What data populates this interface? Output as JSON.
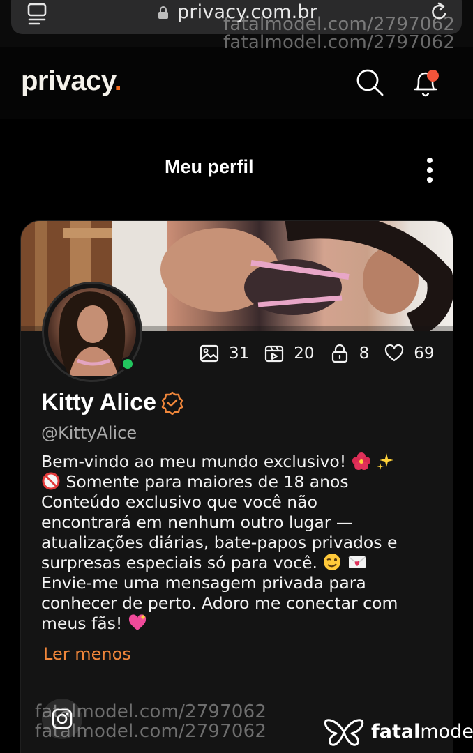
{
  "browser": {
    "url": "privacy.com.br"
  },
  "header": {
    "logo": "privacy",
    "logo_dot": "."
  },
  "page": {
    "title": "Meu perfil"
  },
  "profile": {
    "name": "Kitty Alice",
    "handle": "@KittyAlice",
    "status": "online",
    "stats": {
      "photos": "31",
      "videos": "20",
      "locked": "8",
      "likes": "69"
    },
    "bio_lines": [
      "Bem-vindo ao meu mundo exclusivo!",
      "Somente para maiores de 18 anos",
      "Conteúdo exclusivo que você não",
      "encontrará em nenhum outro lugar —",
      "atualizações diárias, bate-papos privados e",
      "surpresas especiais só para você.",
      "Envie-me uma mensagem privada para",
      "conhecer de perto. Adoro me conectar com",
      "meus fãs!"
    ],
    "read_less": "Ler menos"
  },
  "watermark": {
    "text_1": "fatalmodel.com/2797062",
    "text_2": "fatalmodel.com/2797062",
    "text_3": "fatalmodel.com/2797062",
    "text_4": "fatalmodel.com/2797062",
    "brand_bold": "fatal",
    "brand_rest": "model"
  },
  "colors": {
    "accent": "#f76b1c",
    "read_less": "#f0863a",
    "verified": "#f0863a",
    "online": "#22c55e",
    "notification": "#f2543a"
  }
}
